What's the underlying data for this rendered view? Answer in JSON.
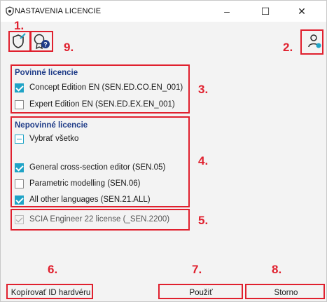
{
  "window": {
    "title": "NASTAVENIA LICENCIE",
    "minimize_glyph": "–",
    "maximize_glyph": "☐",
    "close_glyph": "✕"
  },
  "toolbar": {
    "icons": [
      "shield-check-icon",
      "license-help-icon",
      "user-settings-icon"
    ]
  },
  "callouts": [
    "1.",
    "2.",
    "3.",
    "4.",
    "5.",
    "6.",
    "7.",
    "8.",
    "9."
  ],
  "required": {
    "title": "Povinné licencie",
    "items": [
      {
        "label": "Concept Edition EN (SEN.ED.CO.EN_001)",
        "state": "checked"
      },
      {
        "label": "Expert Edition EN (SEN.ED.EX.EN_001)",
        "state": "unchecked"
      }
    ]
  },
  "optional": {
    "title": "Nepovinné licencie",
    "select_all": {
      "label": "Vybrať všetko",
      "state": "partial"
    },
    "items": [
      {
        "label": "General cross-section editor (SEN.05)",
        "state": "checked"
      },
      {
        "label": "Parametric modelling (SEN.06)",
        "state": "unchecked"
      },
      {
        "label": "All other languages (SEN.21.ALL)",
        "state": "checked"
      }
    ]
  },
  "base_license": {
    "label": "SCIA Engineer 22 license (_SEN.2200)",
    "state": "checked-disabled"
  },
  "buttons": {
    "copy_hw": "Kopírovať ID hardvéru",
    "apply": "Použiť",
    "cancel": "Storno"
  },
  "colors": {
    "accent": "#1fa3c6",
    "callout": "#e0202e",
    "group_title": "#1f3c88"
  }
}
